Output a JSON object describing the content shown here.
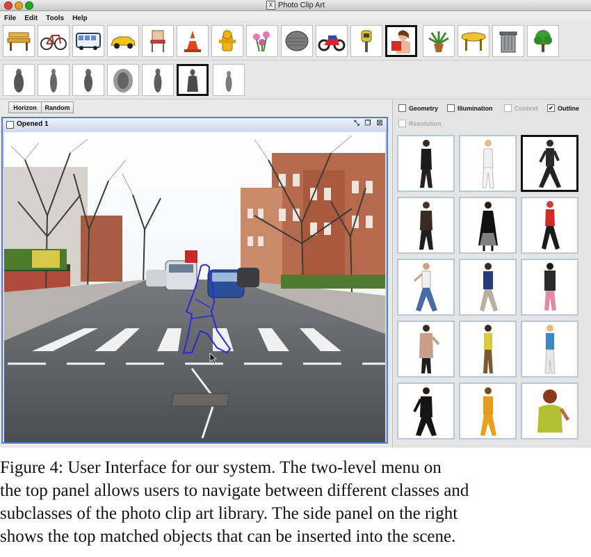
{
  "window": {
    "title": "Photo Clip Art"
  },
  "menu": [
    "File",
    "Edit",
    "Tools",
    "Help"
  ],
  "categories": [
    {
      "icon": "bench-icon"
    },
    {
      "icon": "bicycle-icon"
    },
    {
      "icon": "bus-icon"
    },
    {
      "icon": "car-icon"
    },
    {
      "icon": "chair-icon"
    },
    {
      "icon": "traffic-cone-icon"
    },
    {
      "icon": "fire-hydrant-icon"
    },
    {
      "icon": "flowers-icon"
    },
    {
      "icon": "manhole-icon"
    },
    {
      "icon": "motorcycle-icon"
    },
    {
      "icon": "parking-meter-icon"
    },
    {
      "icon": "person-icon",
      "selected": true
    },
    {
      "icon": "potted-plant-icon"
    },
    {
      "icon": "table-icon"
    },
    {
      "icon": "trash-can-icon"
    },
    {
      "icon": "tree-icon"
    }
  ],
  "subclasses": [
    {
      "icon": "person-silhouette-icon"
    },
    {
      "icon": "person-silhouette-icon"
    },
    {
      "icon": "person-silhouette-icon"
    },
    {
      "icon": "person-silhouette-icon"
    },
    {
      "icon": "person-silhouette-icon"
    },
    {
      "icon": "person-silhouette-icon",
      "selected": true
    },
    {
      "icon": "person-silhouette-icon"
    }
  ],
  "workspace": {
    "horizon_button": "Horizon",
    "random_button": "Random",
    "frame_title": "Opened 1"
  },
  "options": {
    "geometry": {
      "label": "Geometry",
      "checked": false,
      "enabled": true
    },
    "illumination": {
      "label": "Illumination",
      "checked": false,
      "enabled": true
    },
    "context": {
      "label": "Context",
      "checked": false,
      "enabled": false
    },
    "outline": {
      "label": "Outline",
      "checked": true,
      "enabled": true
    },
    "resolution": {
      "label": "Resolution",
      "checked": false,
      "enabled": false
    }
  },
  "results": [
    {
      "icon": "person-walking-icon"
    },
    {
      "icon": "person-walking-icon"
    },
    {
      "icon": "person-walking-icon",
      "selected": true
    },
    {
      "icon": "person-walking-icon"
    },
    {
      "icon": "person-walking-icon"
    },
    {
      "icon": "person-walking-icon"
    },
    {
      "icon": "person-walking-icon"
    },
    {
      "icon": "person-walking-icon"
    },
    {
      "icon": "person-walking-icon"
    },
    {
      "icon": "person-walking-icon"
    },
    {
      "icon": "person-walking-icon"
    },
    {
      "icon": "person-walking-icon"
    },
    {
      "icon": "person-walking-icon"
    },
    {
      "icon": "person-walking-icon"
    },
    {
      "icon": "person-walking-icon"
    }
  ],
  "caption": [
    "Figure 4:  User Interface for our system.  The two-level menu on",
    "the top panel allows users to navigate between different classes and",
    "subclasses of the photo clip art library. The side panel on the right",
    "shows the top matched objects that can be inserted into the scene."
  ]
}
